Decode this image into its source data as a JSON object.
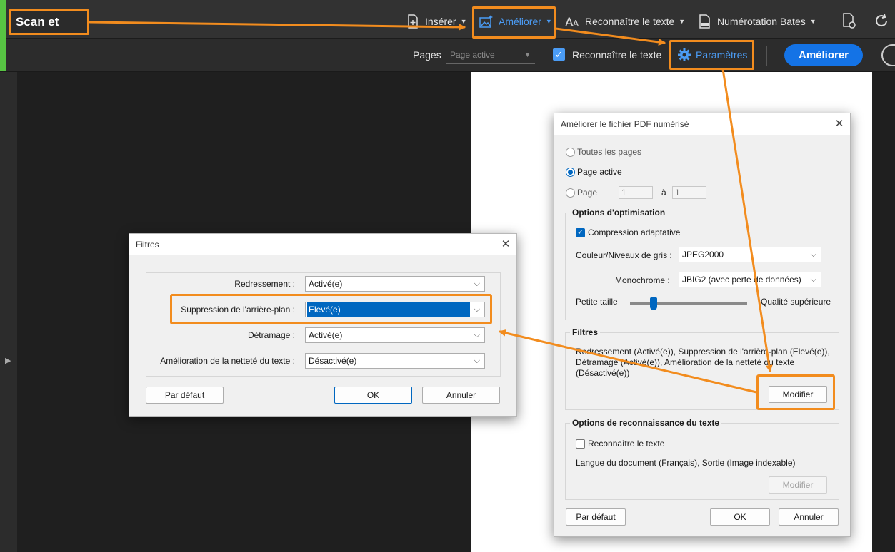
{
  "app": {
    "title": "Scan et OCR"
  },
  "toolbar": {
    "insert": "Insérer",
    "improve": "Améliorer",
    "recognize": "Reconnaître le texte",
    "bates": "Numérotation Bates"
  },
  "subbar": {
    "pages_label": "Pages",
    "pages_value": "Page active",
    "ocr_label": "Reconnaître le texte",
    "params_label": "Paramètres",
    "primary_button": "Améliorer"
  },
  "improve_dialog": {
    "title": "Améliorer le fichier PDF numérisé",
    "radio_all": "Toutes les pages",
    "radio_current": "Page active",
    "radio_page": "Page",
    "page_from": "1",
    "page_to_label": "à",
    "page_to": "1",
    "opt_group": "Options d'optimisation",
    "adaptive": "Compression adaptative",
    "color_label": "Couleur/Niveaux de gris :",
    "color_value": "JPEG2000",
    "mono_label": "Monochrome :",
    "mono_value": "JBIG2 (avec perte de données)",
    "slider_min": "Petite taille",
    "slider_max": "Qualité supérieure",
    "slider_level": 0.2,
    "filters_group": "Filtres",
    "filters_summary_1": "Redressement (Activé(e)), Suppression de l'arrière-plan (Elevé(e)),",
    "filters_summary_2": "Détramage (Activé(e)), Amélioration de la netteté du texte",
    "filters_summary_3": "(Désactivé(e))",
    "modify": "Modifier",
    "ocr_group": "Options de reconnaissance du texte",
    "ocr_check": "Reconnaître le texte",
    "ocr_summary": "Langue du document (Français), Sortie (Image indexable)",
    "ocr_modify": "Modifier",
    "default": "Par défaut",
    "ok": "OK",
    "cancel": "Annuler"
  },
  "filters_dialog": {
    "title": "Filtres",
    "rows": [
      {
        "label": "Redressement :",
        "value": "Activé(e)"
      },
      {
        "label": "Suppression de l'arrière-plan :",
        "value": "Elevé(e)"
      },
      {
        "label": "Détramage :",
        "value": "Activé(e)"
      },
      {
        "label": "Amélioration de la netteté du texte :",
        "value": "Désactivé(e)"
      }
    ],
    "default": "Par défaut",
    "ok": "OK",
    "cancel": "Annuler"
  },
  "colors": {
    "accent": "#4b9cf5",
    "highlight": "#f28c1e",
    "primary": "#1473e6"
  }
}
